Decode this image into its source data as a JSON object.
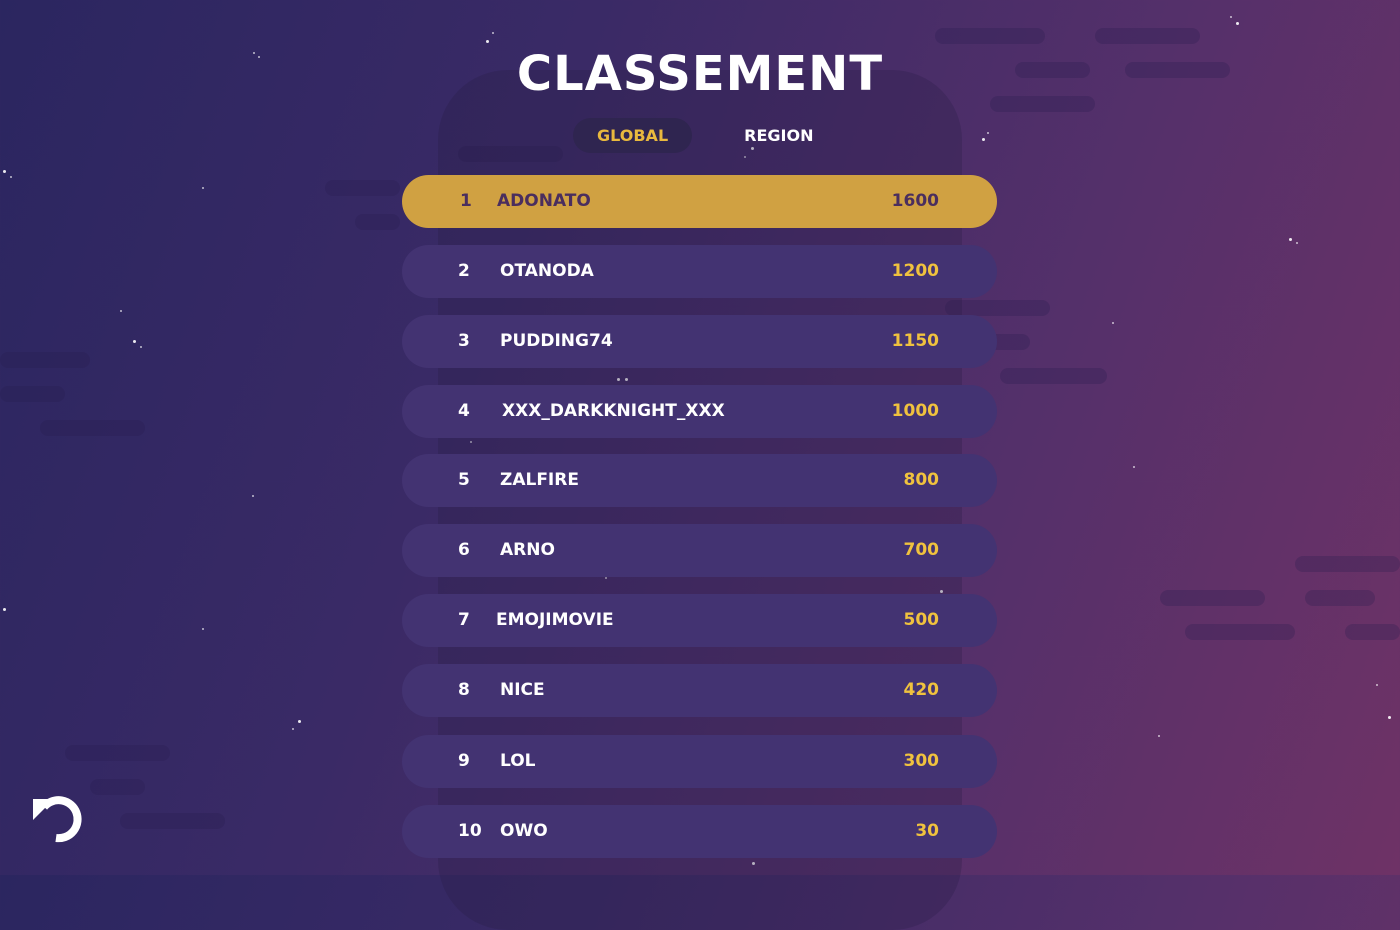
{
  "title": "CLASSEMENT",
  "tabs": [
    {
      "label": "GLOBAL",
      "active": true
    },
    {
      "label": "REGION",
      "active": false
    }
  ],
  "leaderboard": [
    {
      "rank": "1",
      "name": "ADONATO",
      "score": "1600"
    },
    {
      "rank": "2",
      "name": "OTANODA",
      "score": "1200"
    },
    {
      "rank": "3",
      "name": "PUDDING74",
      "score": "1150"
    },
    {
      "rank": "4",
      "name": "XXX_DARKKNIGHT_XXX",
      "score": "1000"
    },
    {
      "rank": "5",
      "name": "ZALFIRE",
      "score": "800"
    },
    {
      "rank": "6",
      "name": "ARNO",
      "score": "700"
    },
    {
      "rank": "7",
      "name": "EMOJIMOVIE",
      "score": "500"
    },
    {
      "rank": "8",
      "name": "NICE",
      "score": "420"
    },
    {
      "rank": "9",
      "name": "LOL",
      "score": "300"
    },
    {
      "rank": "10",
      "name": "OWO",
      "score": "30"
    }
  ],
  "icons": {
    "back": "undo-arrow-icon"
  },
  "colors": {
    "accent": "#d0a142",
    "score": "#f0c23e",
    "row": "#433372",
    "tab_active_bg": "#2f2550"
  }
}
